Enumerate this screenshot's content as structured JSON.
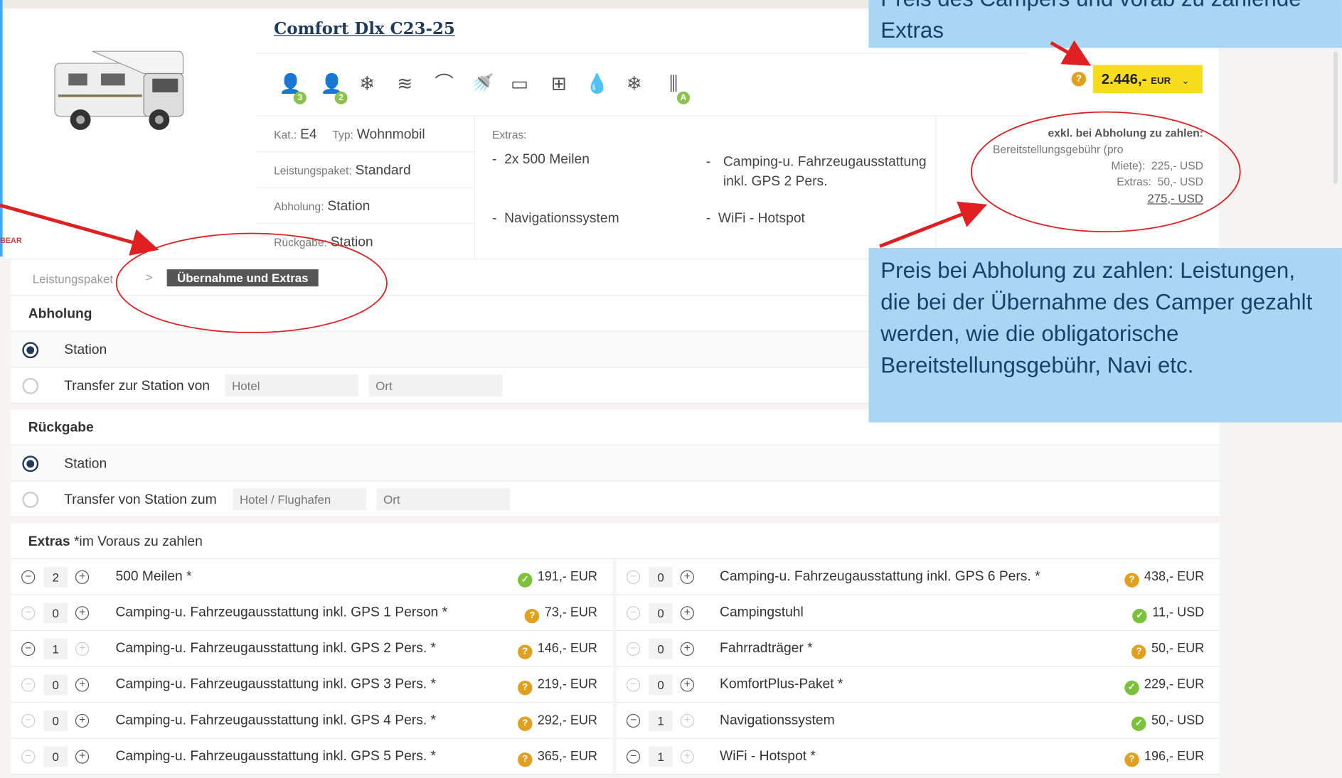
{
  "vehicle": {
    "title": "Comfort Dlx C23-25",
    "image_alt": "Wohnmobil",
    "icons": [
      {
        "name": "adult-person-icon",
        "glyph": "👤",
        "badge": "3"
      },
      {
        "name": "child-person-icon",
        "glyph": "👤",
        "badge": "2"
      },
      {
        "name": "air-conditioning-icon",
        "glyph": "❄",
        "badge": ""
      },
      {
        "name": "heating-icon",
        "glyph": "≋",
        "badge": ""
      },
      {
        "name": "toilet-icon",
        "glyph": "⌒",
        "badge": ""
      },
      {
        "name": "shower-icon",
        "glyph": "🚿",
        "badge": ""
      },
      {
        "name": "microwave-icon",
        "glyph": "▭",
        "badge": ""
      },
      {
        "name": "stove-icon",
        "glyph": "⊞",
        "badge": ""
      },
      {
        "name": "water-tank-icon",
        "glyph": "💧",
        "badge": ""
      },
      {
        "name": "refrigerator-icon",
        "glyph": "❄",
        "badge": ""
      },
      {
        "name": "transmission-icon",
        "glyph": "⫼",
        "badge": "A"
      }
    ],
    "info": {
      "kat_label": "Kat.:",
      "kat_value": "E4",
      "typ_label": "Typ:",
      "typ_value": "Wohnmobil",
      "paket_label": "Leistungspaket:",
      "paket_value": "Standard",
      "abholung_label": "Abholung:",
      "abholung_value": "Station",
      "rueckgabe_label": "Rückgabe:",
      "rueckgabe_value": "Station"
    },
    "extras_label": "Extras:",
    "extras_left": [
      "2x 500 Meilen",
      "Navigationssystem"
    ],
    "extras_right_1": "Camping-u. Fahrzeugausstattung inkl. GPS 2 Pers.",
    "extras_right_2": "WiFi - Hotspot",
    "price": {
      "amount": "2.446,-",
      "currency": "EUR"
    },
    "pickup_pay": {
      "heading": "exkl. bei Abholung zu zahlen:",
      "fee_label": "Bereitstellungsgebühr (pro",
      "miete_label": "Miete):",
      "miete_value": "225,- USD",
      "extras_label": "Extras:",
      "extras_value": "50,- USD",
      "total": "275,- USD"
    }
  },
  "breadcrumb": {
    "step1": "Leistungspaket",
    "sep": ">",
    "step2": "Übernahme und Extras"
  },
  "abholung": {
    "heading": "Abholung",
    "option_station": "Station",
    "option_transfer": "Transfer zur Station von",
    "hotel_placeholder": "Hotel",
    "ort_placeholder": "Ort"
  },
  "rueckgabe": {
    "heading": "Rückgabe",
    "option_station": "Station",
    "option_transfer": "Transfer von Station zum",
    "hotel_placeholder": "Hotel / Flughafen",
    "ort_placeholder": "Ort"
  },
  "extras": {
    "heading": "Extras",
    "note": "*im Voraus zu zahlen",
    "left": [
      {
        "qty": "2",
        "name": "500 Meilen *",
        "price": "191,- EUR",
        "status": "green",
        "minus": true,
        "plus": true
      },
      {
        "qty": "0",
        "name": "Camping-u. Fahrzeugausstattung inkl. GPS 1 Person *",
        "price": "73,- EUR",
        "status": "orange",
        "minus": false,
        "plus": true
      },
      {
        "qty": "1",
        "name": "Camping-u. Fahrzeugausstattung inkl. GPS 2 Pers. *",
        "price": "146,- EUR",
        "status": "orange",
        "minus": true,
        "plus": false
      },
      {
        "qty": "0",
        "name": "Camping-u. Fahrzeugausstattung inkl. GPS 3 Pers. *",
        "price": "219,- EUR",
        "status": "orange",
        "minus": false,
        "plus": true
      },
      {
        "qty": "0",
        "name": "Camping-u. Fahrzeugausstattung inkl. GPS 4 Pers. *",
        "price": "292,- EUR",
        "status": "orange",
        "minus": false,
        "plus": true
      },
      {
        "qty": "0",
        "name": "Camping-u. Fahrzeugausstattung inkl. GPS 5 Pers. *",
        "price": "365,- EUR",
        "status": "orange",
        "minus": false,
        "plus": true
      }
    ],
    "right": [
      {
        "qty": "0",
        "name": "Camping-u. Fahrzeugausstattung inkl. GPS 6 Pers. *",
        "price": "438,- EUR",
        "status": "orange",
        "minus": false,
        "plus": true
      },
      {
        "qty": "0",
        "name": "Campingstuhl",
        "price": "11,- USD",
        "status": "green",
        "minus": false,
        "plus": true
      },
      {
        "qty": "0",
        "name": "Fahrradträger *",
        "price": "50,- EUR",
        "status": "orange",
        "minus": false,
        "plus": true
      },
      {
        "qty": "0",
        "name": "KomfortPlus-Paket *",
        "price": "229,- EUR",
        "status": "green",
        "minus": false,
        "plus": true
      },
      {
        "qty": "1",
        "name": "Navigationssystem",
        "price": "50,- USD",
        "status": "green",
        "minus": true,
        "plus": false
      },
      {
        "qty": "1",
        "name": "WiFi - Hotspot *",
        "price": "196,- EUR",
        "status": "orange",
        "minus": true,
        "plus": false
      }
    ]
  },
  "callouts": {
    "top": "Preis des Campers und vorab zu zahlende Extras",
    "middle": "Preis bei Abholung zu zahlen: Leistungen, die bei der Übernahme des Camper gezahlt werden, wie die obligatorische Bereitstellungsgebühr, Navi etc."
  },
  "colors": {
    "accent": "#f7dc1c",
    "navy": "#1f3a5f",
    "callout_bg": "#a9d7f3",
    "annotation_red": "#e02020"
  }
}
